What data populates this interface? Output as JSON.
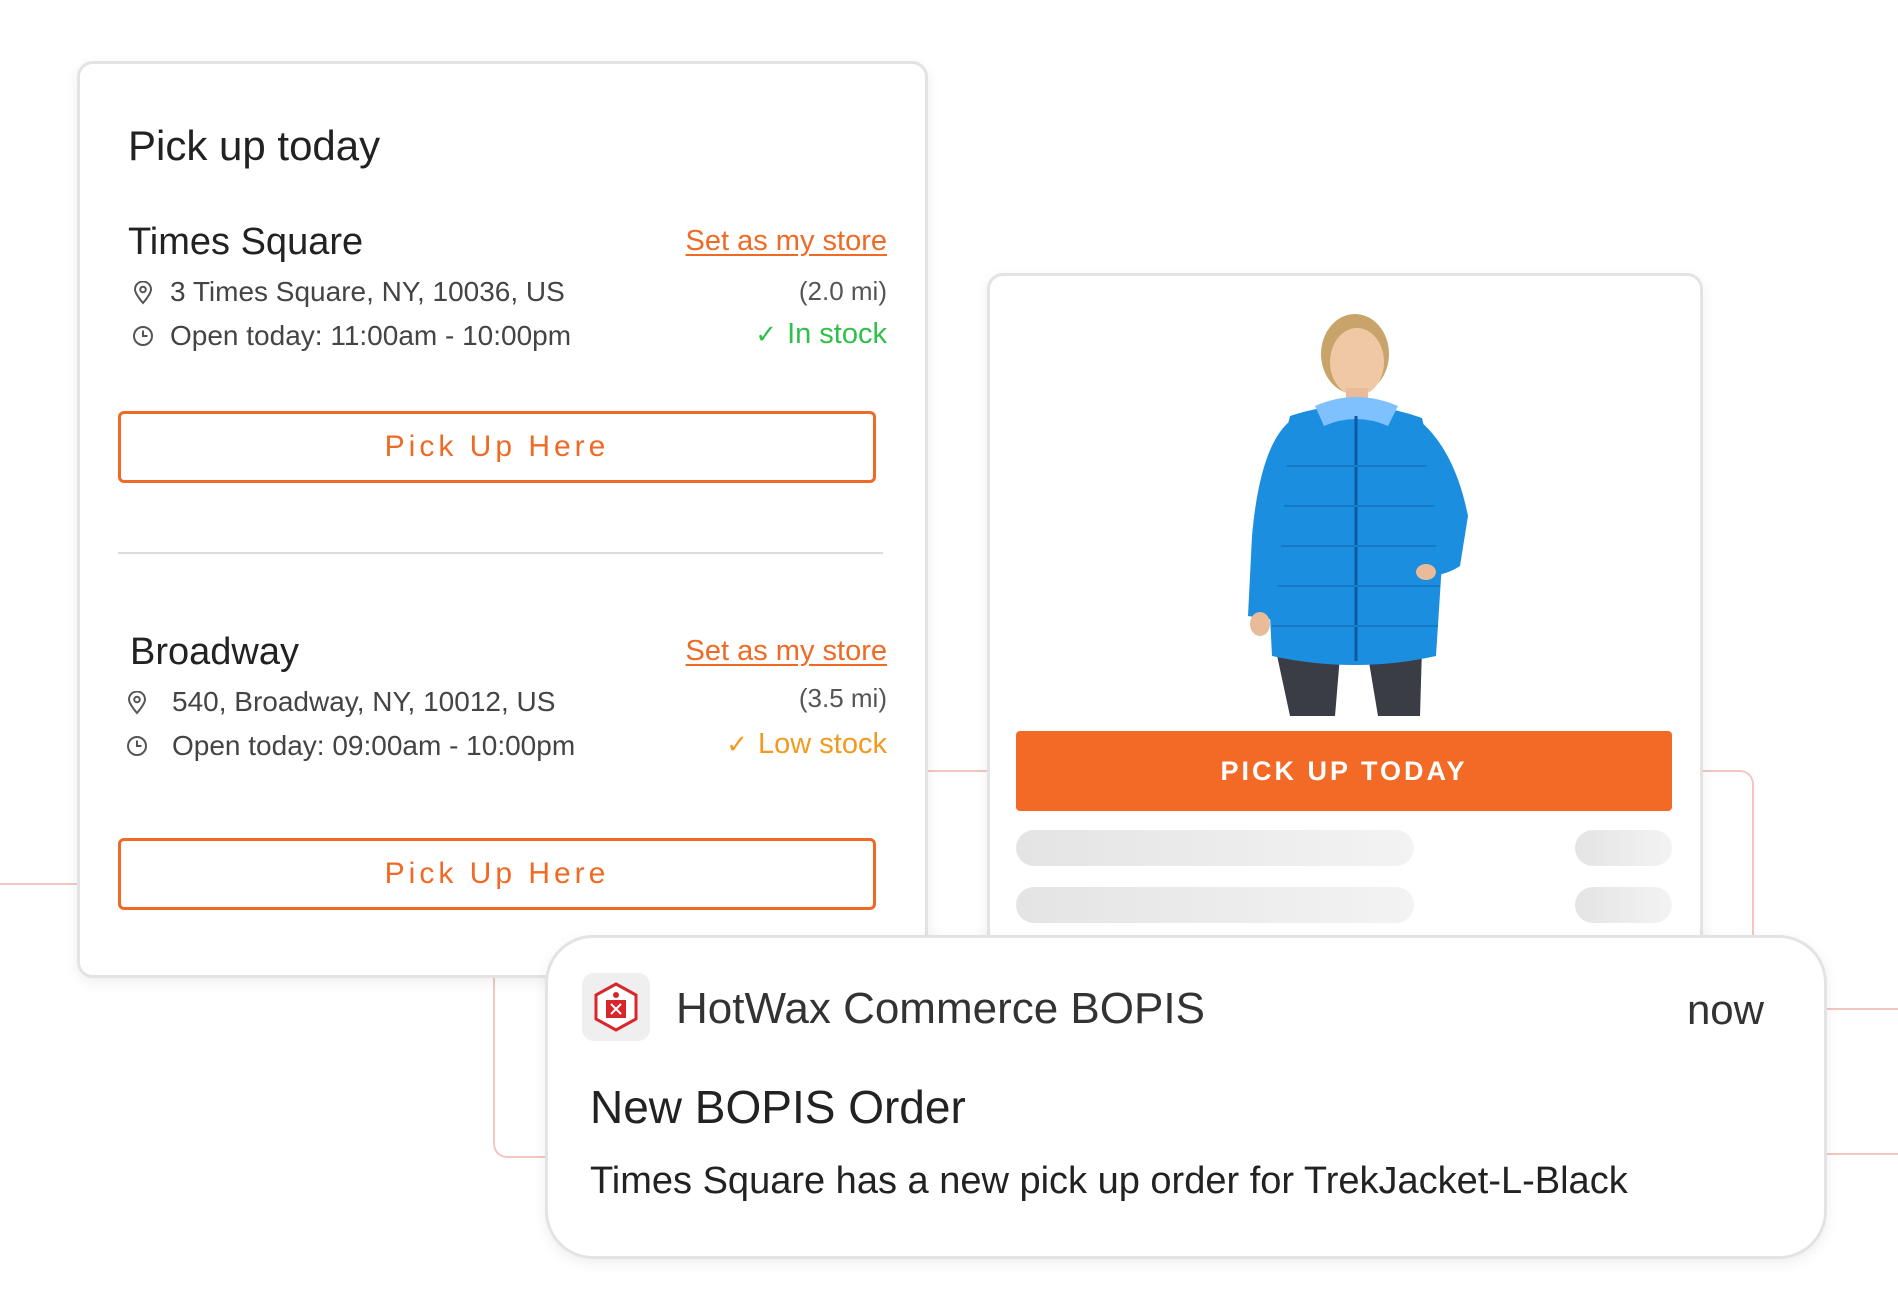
{
  "pickup": {
    "title": "Pick up today",
    "stores": [
      {
        "name": "Times Square",
        "set_store_label": "Set as my store",
        "address": "3 Times Square, NY, 10036, US",
        "hours": "Open today: 11:00am - 10:00pm",
        "distance": "(2.0 mi)",
        "stock_label": "In stock",
        "stock_color": "#2fbf4a",
        "button_label": "Pick Up Here"
      },
      {
        "name": "Broadway",
        "set_store_label": "Set as my store",
        "address": "540, Broadway, NY, 10012, US",
        "hours": "Open today: 09:00am - 10:00pm",
        "distance": "(3.5 mi)",
        "stock_label": "Low stock",
        "stock_color": "#f29a1f",
        "button_label": "Pick Up Here"
      }
    ]
  },
  "product": {
    "image_icon": "woman-blue-jacket-photo",
    "button_label": "PICK UP TODAY"
  },
  "notification": {
    "app_name": "HotWax Commerce BOPIS",
    "time": "now",
    "title": "New BOPIS Order",
    "body": "Times Square has a new pick up order for TrekJacket-L-Black"
  },
  "colors": {
    "accent": "#ef6a25",
    "in_stock": "#2fbf4a",
    "low_stock": "#f29a1f"
  }
}
